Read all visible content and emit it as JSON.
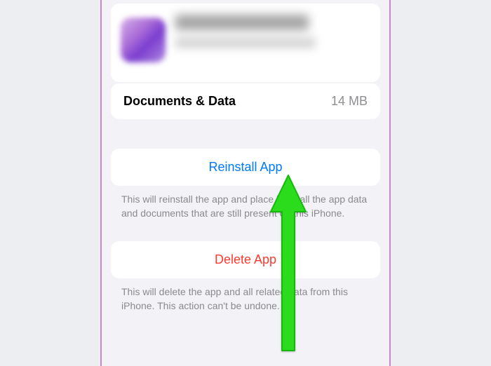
{
  "storage": {
    "documents_label": "Documents & Data",
    "documents_value": "14 MB"
  },
  "reinstall": {
    "label": "Reinstall App",
    "hint": "This will reinstall the app and place back all the app data and documents that are still present on this iPhone."
  },
  "delete": {
    "label": "Delete App",
    "hint": "This will delete the app and all related data from this iPhone. This action can't be undone."
  }
}
